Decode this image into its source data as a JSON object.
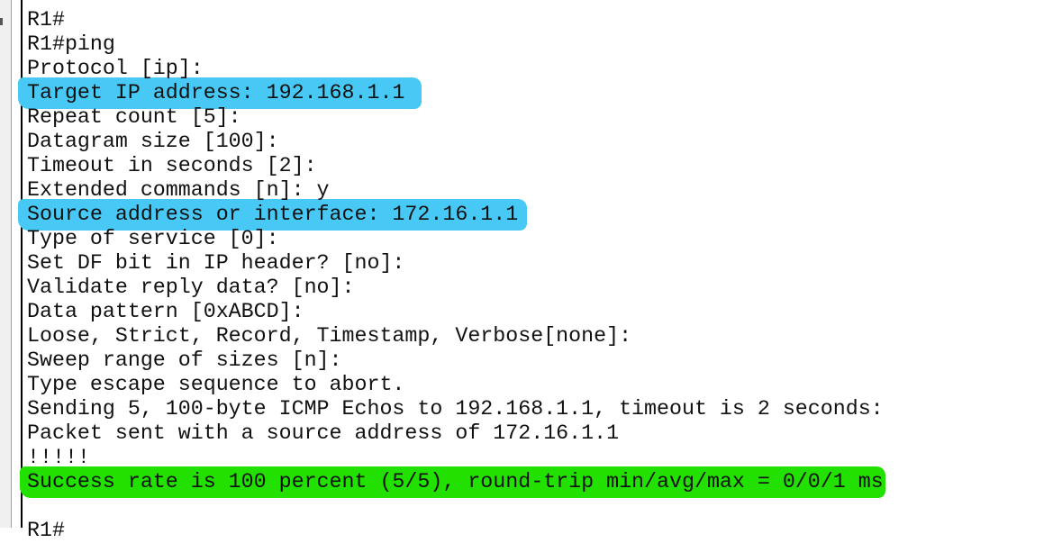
{
  "colors": {
    "highlight_blue": "#47c8f5",
    "highlight_green": "#22e000"
  },
  "terminal": {
    "lines": [
      "R1#",
      "R1#ping",
      "Protocol [ip]:",
      "Target IP address: 192.168.1.1",
      "Repeat count [5]:",
      "Datagram size [100]:",
      "Timeout in seconds [2]:",
      "Extended commands [n]: y",
      "Source address or interface: 172.16.1.1",
      "Type of service [0]:",
      "Set DF bit in IP header? [no]:",
      "Validate reply data? [no]:",
      "Data pattern [0xABCD]:",
      "Loose, Strict, Record, Timestamp, Verbose[none]:",
      "Sweep range of sizes [n]:",
      "Type escape sequence to abort.",
      "Sending 5, 100-byte ICMP Echos to 192.168.1.1, timeout is 2 seconds:",
      "Packet sent with a source address of 172.16.1.1",
      "!!!!!",
      "Success rate is 100 percent (5/5), round-trip min/avg/max = 0/0/1 ms",
      "",
      "R1#"
    ]
  }
}
